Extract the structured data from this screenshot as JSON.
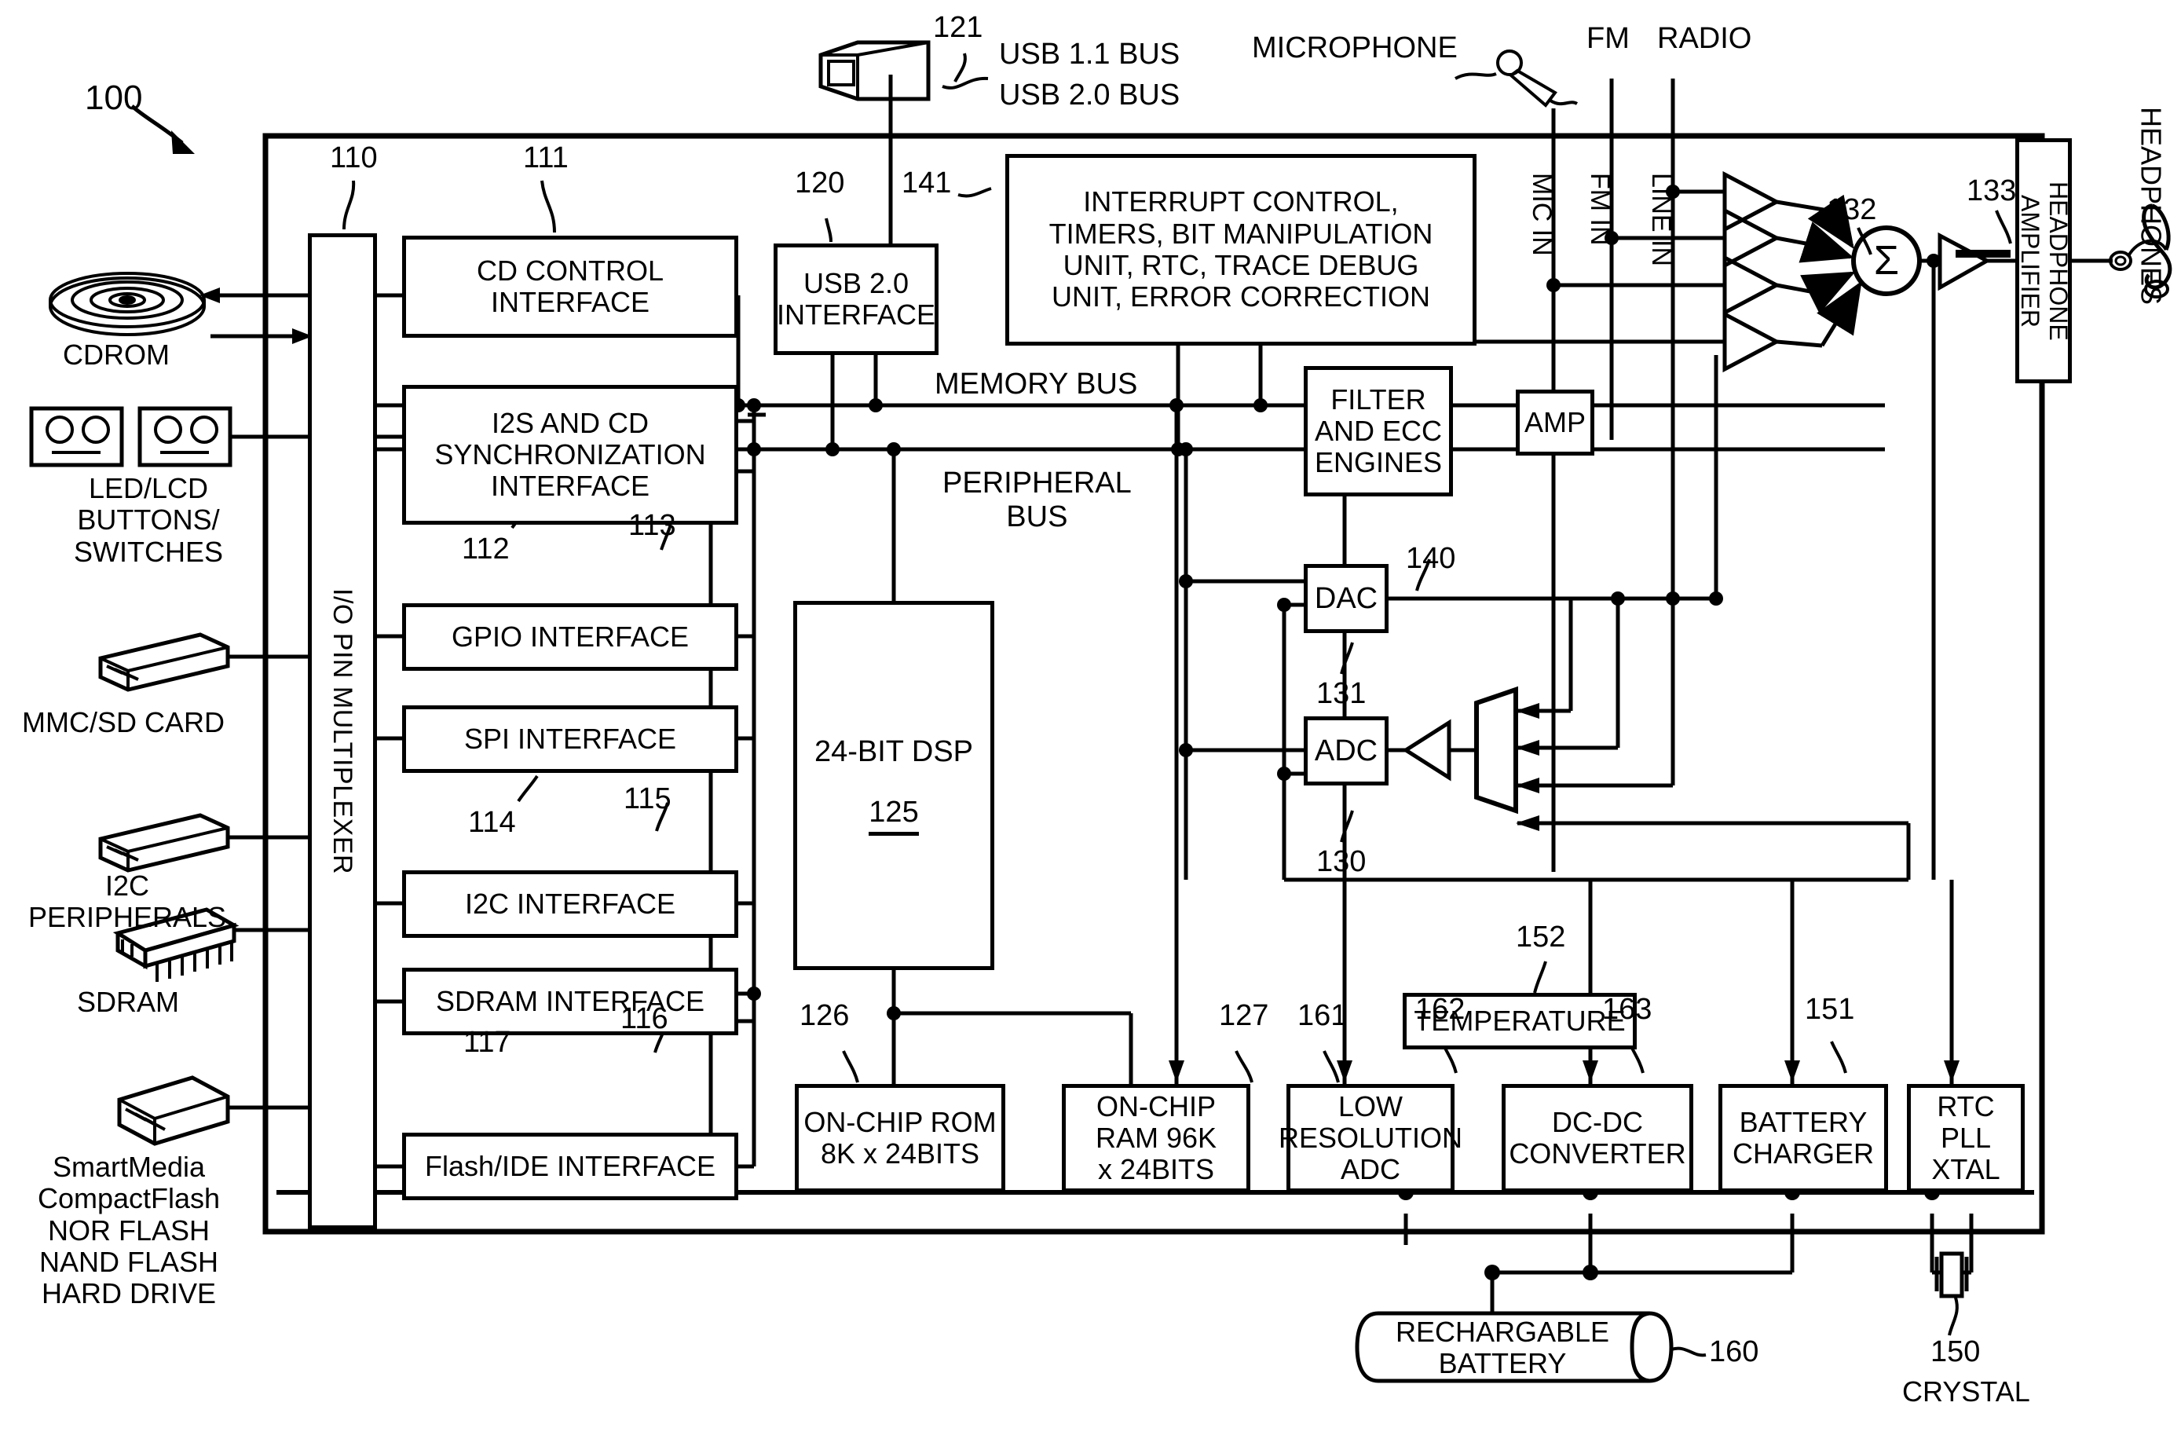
{
  "diagram": {
    "figure_ref": "100",
    "peripherals_left": [
      {
        "ref_label": "CDROM",
        "icon": "cdrom-disc-icon"
      },
      {
        "ref_label": "LED/LCD\nBUTTONS/\nSWITCHES",
        "icon": "led-lcd-panel-icon"
      },
      {
        "ref_label": "MMC/SD CARD",
        "icon": "memory-card-icon"
      },
      {
        "ref_label": "I2C\nPERIPHERALS",
        "icon": "memory-card-icon"
      },
      {
        "ref_label": "SDRAM",
        "icon": "dram-chip-icon"
      },
      {
        "ref_label": "SmartMedia\nCompactFlash\nNOR FLASH\nNAND FLASH\nHARD DRIVE",
        "icon": "flash-card-icon"
      }
    ],
    "mux": {
      "label": "I/O PIN MULTIPLEXER",
      "ref": "110"
    },
    "interfaces": [
      {
        "label": "CD CONTROL\nINTERFACE",
        "ref": "111"
      },
      {
        "label": "I2S AND CD\nSYNCHRONIZATION\nINTERFACE",
        "ref": "112"
      },
      {
        "label": "GPIO INTERFACE",
        "ref": "113"
      },
      {
        "label": "SPI INTERFACE",
        "ref": "114"
      },
      {
        "label": "I2C INTERFACE",
        "ref": "115"
      },
      {
        "label": "SDRAM INTERFACE",
        "ref": "117"
      },
      {
        "label": "Flash/IDE INTERFACE",
        "ref": "116"
      }
    ],
    "usb": {
      "connector_ref": "121",
      "bus_line1": "USB 1.1 BUS",
      "bus_line2": "USB 2.0 BUS",
      "interface_label": "USB 2.0\nINTERFACE",
      "interface_ref": "120"
    },
    "control_block": {
      "label": "INTERRUPT CONTROL,\nTIMERS, BIT MANIPULATION\nUNIT, RTC, TRACE DEBUG\nUNIT, ERROR CORRECTION",
      "ref": "141"
    },
    "buses": [
      {
        "name": "MEMORY BUS"
      },
      {
        "name": "PERIPHERAL\nBUS"
      }
    ],
    "dsp": {
      "label": "24-BIT DSP",
      "ref": "125"
    },
    "memories": [
      {
        "label": "ON-CHIP ROM\n8K x 24BITS",
        "ref": "126"
      },
      {
        "label": "ON-CHIP\nRAM 96K\nx 24BITS",
        "ref": "127"
      }
    ],
    "filter_ecc": {
      "label": "FILTER\nAND ECC\nENGINES",
      "ref": "140"
    },
    "dac": {
      "label": "DAC",
      "ref": "131"
    },
    "adc": {
      "label": "ADC",
      "ref": "130"
    },
    "amp": {
      "label": "AMP"
    },
    "mixer": {
      "symbol": "Σ",
      "ref": "132"
    },
    "headphone_amp": {
      "label": "HEADPHONE AMPLIFIER",
      "ref": "133"
    },
    "headphones_label": "HEADPHONES",
    "audio_inputs": [
      {
        "source": "MICROPHONE",
        "pin": "MIC IN"
      },
      {
        "source": "FM",
        "pin": "FM IN"
      },
      {
        "source": "RADIO",
        "pin": "LINE IN"
      }
    ],
    "power_blocks": [
      {
        "label": "TEMPERATURE",
        "ref": "152"
      },
      {
        "label": "LOW\nRESOLUTION\nADC",
        "ref": "161"
      },
      {
        "label": "DC-DC\nCONVERTER",
        "ref": "162"
      },
      {
        "label": "BATTERY\nCHARGER",
        "ref": "163"
      },
      {
        "label": "RTC\nPLL\nXTAL",
        "ref": "151"
      }
    ],
    "battery": {
      "label": "RECHARGABLE\nBATTERY",
      "ref": "160"
    },
    "crystal": {
      "label": "CRYSTAL",
      "ref": "150"
    }
  }
}
